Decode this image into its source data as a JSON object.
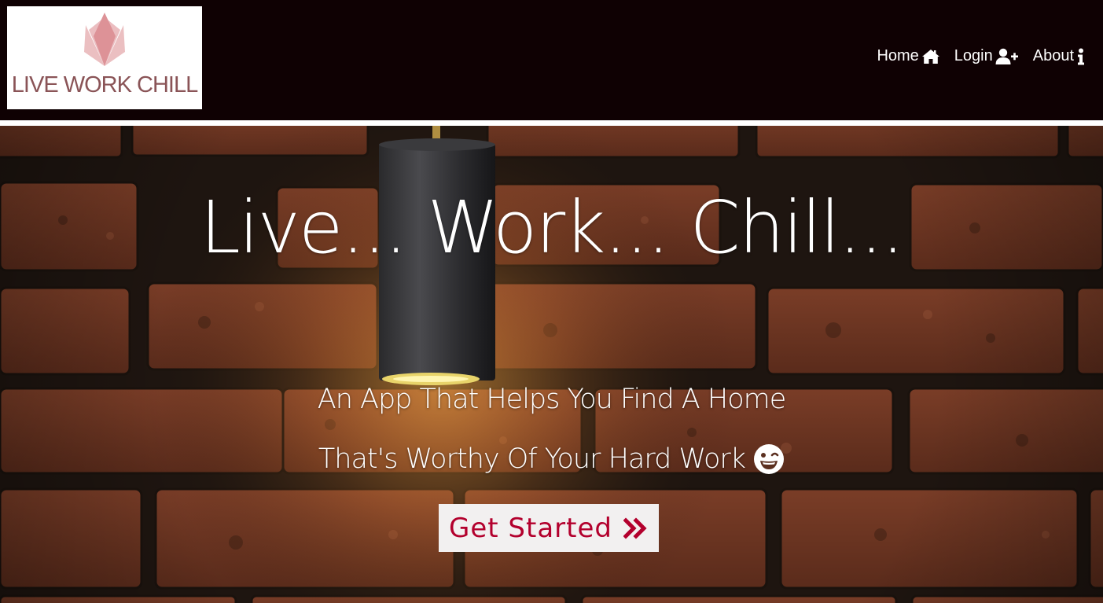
{
  "header": {
    "logo_text": "LIVE WORK CHILL",
    "nav": [
      {
        "label": "Home",
        "icon": "home-icon"
      },
      {
        "label": "Login",
        "icon": "user-plus-icon"
      },
      {
        "label": "About",
        "icon": "info-icon"
      }
    ]
  },
  "hero": {
    "title": "Live... Work... Chill...",
    "line1": "An App That Helps You Find A Home",
    "line2": "That's Worthy Of Your Hard Work",
    "line2_icon": "grin-wink-icon",
    "cta_label": "Get Started",
    "cta_icon": "double-chevron-right-icon"
  },
  "colors": {
    "navbar_bg": "#0f0103",
    "logo_text": "#8a5457",
    "logo_mark": "#d88a8e",
    "cta_text": "#b3002d",
    "cta_bg": "#f2f0f0",
    "brick": "#6b3522"
  }
}
